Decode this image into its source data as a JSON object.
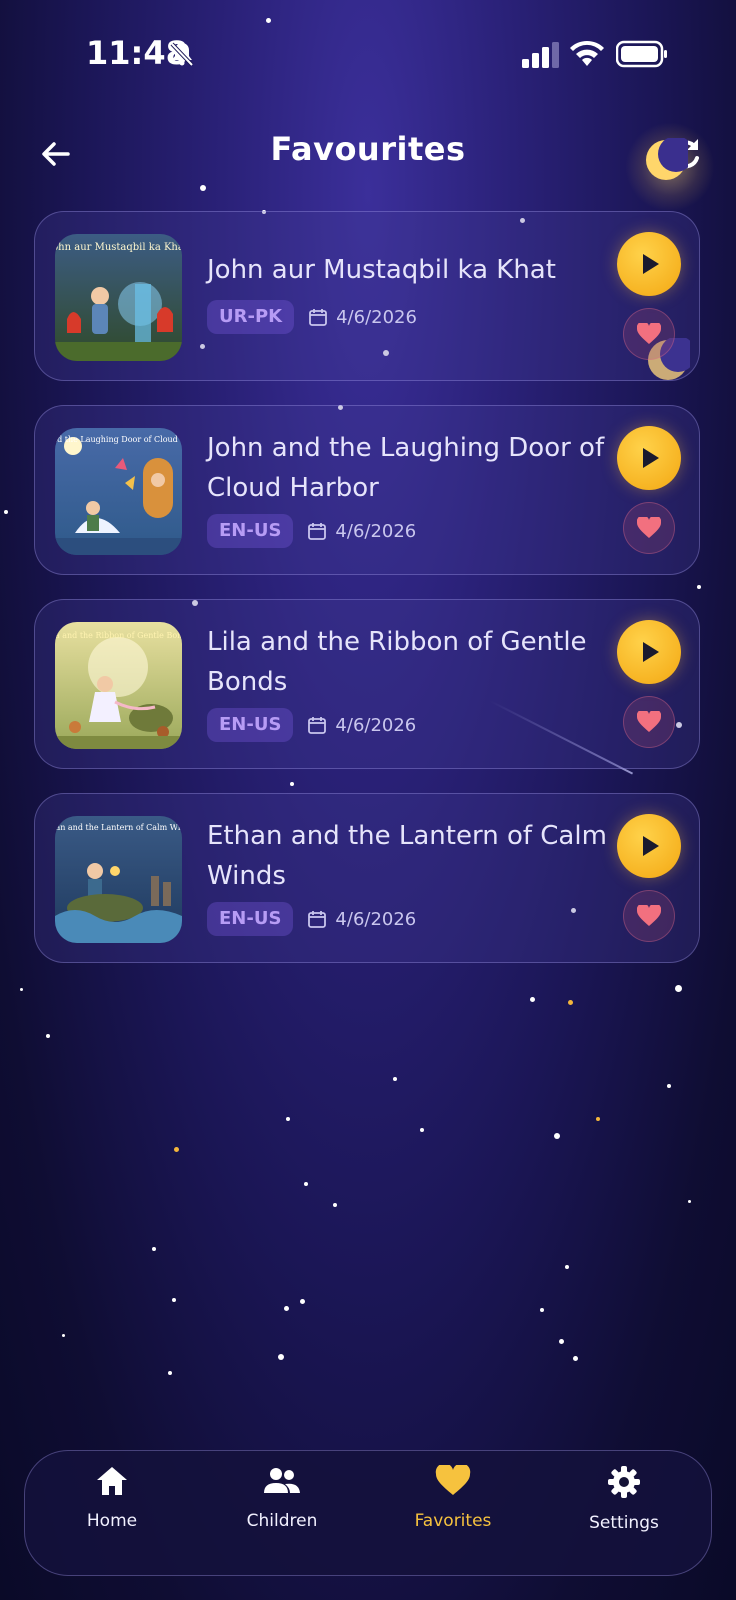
{
  "status_bar": {
    "time": "11:48"
  },
  "header": {
    "title": "Favourites"
  },
  "colors": {
    "accent": "#f6c23e",
    "background": "#1b1656",
    "heart": "#f2707f",
    "language_tag": "#b79cf5"
  },
  "stories": [
    {
      "title": "John aur Mustaqbil ka Khat",
      "language": "UR-PK",
      "date": "4/6/2026",
      "cover_text": "John aur Mustaqbil ka Khat"
    },
    {
      "title": "John and the Laughing Door of Cloud Harbor",
      "language": "EN-US",
      "date": "4/6/2026",
      "cover_text": "John and the Laughing Door of Cloud Harbor"
    },
    {
      "title": "Lila and the Ribbon of Gentle Bonds",
      "language": "EN-US",
      "date": "4/6/2026",
      "cover_text": "Lila and the Ribbon of Gentle Bonds"
    },
    {
      "title": "Ethan and the Lantern of Calm Winds",
      "language": "EN-US",
      "date": "4/6/2026",
      "cover_text": "Ethan and the Lantern of Calm Winds"
    }
  ],
  "nav": {
    "items": [
      {
        "label": "Home",
        "icon": "home-icon"
      },
      {
        "label": "Children",
        "icon": "people-icon"
      },
      {
        "label": "Favorites",
        "icon": "heart-icon",
        "active": true
      },
      {
        "label": "Settings",
        "icon": "gear-icon"
      }
    ]
  }
}
